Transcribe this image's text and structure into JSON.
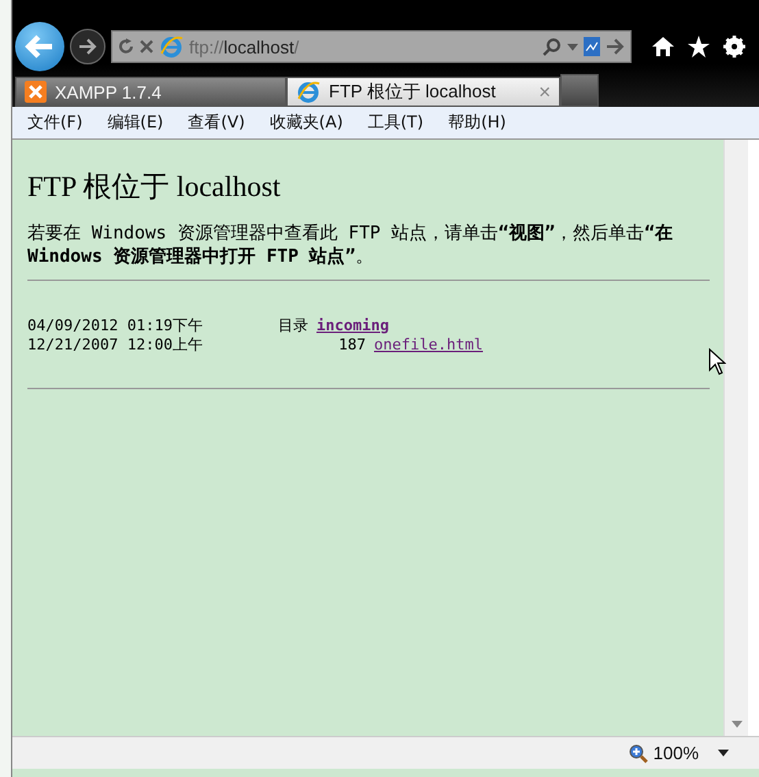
{
  "address_bar": {
    "url_scheme": "ftp://",
    "url_host": "localhost",
    "url_rest": "/"
  },
  "tabs": [
    {
      "label": "XAMPP 1.7.4",
      "selected": false,
      "kind": "xampp"
    },
    {
      "label": "FTP 根位于 localhost",
      "selected": true,
      "kind": "ie"
    }
  ],
  "close_tab": "×",
  "menu": [
    "文件(F)",
    "编辑(E)",
    "查看(V)",
    "收藏夹(A)",
    "工具(T)",
    "帮助(H)"
  ],
  "page": {
    "title": "FTP 根位于 localhost",
    "instructions": "若要在 Windows 资源管理器中查看此 FTP 站点，请单击**“视图”**，然后单击**“在 Windows 资源管理器中打开 FTP 站点”**。",
    "listing": [
      {
        "date": "04/09/2012 01:19下午",
        "size": "目录",
        "name": "incoming",
        "kind": "directory"
      },
      {
        "date": "12/21/2007 12:00上午",
        "size": "187",
        "name": "onefile.html",
        "kind": "file"
      }
    ]
  },
  "status_bar": {
    "zoom": "100%"
  }
}
